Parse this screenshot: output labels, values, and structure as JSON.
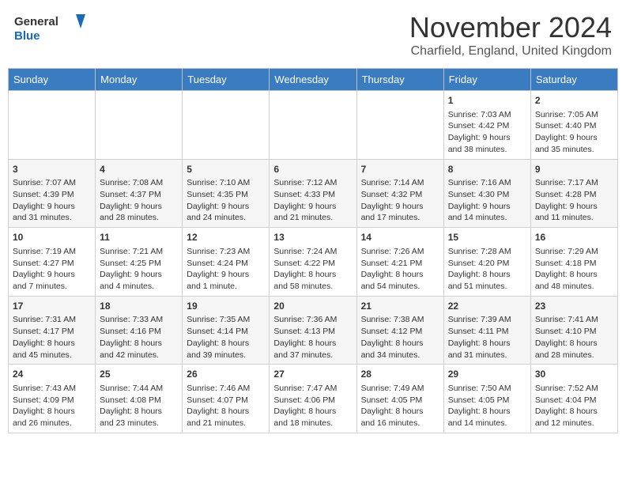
{
  "header": {
    "logo_general": "General",
    "logo_blue": "Blue",
    "month_title": "November 2024",
    "location": "Charfield, England, United Kingdom"
  },
  "weekdays": [
    "Sunday",
    "Monday",
    "Tuesday",
    "Wednesday",
    "Thursday",
    "Friday",
    "Saturday"
  ],
  "weeks": [
    {
      "days": [
        {
          "number": "",
          "info": ""
        },
        {
          "number": "",
          "info": ""
        },
        {
          "number": "",
          "info": ""
        },
        {
          "number": "",
          "info": ""
        },
        {
          "number": "",
          "info": ""
        },
        {
          "number": "1",
          "info": "Sunrise: 7:03 AM\nSunset: 4:42 PM\nDaylight: 9 hours and 38 minutes."
        },
        {
          "number": "2",
          "info": "Sunrise: 7:05 AM\nSunset: 4:40 PM\nDaylight: 9 hours and 35 minutes."
        }
      ]
    },
    {
      "days": [
        {
          "number": "3",
          "info": "Sunrise: 7:07 AM\nSunset: 4:39 PM\nDaylight: 9 hours and 31 minutes."
        },
        {
          "number": "4",
          "info": "Sunrise: 7:08 AM\nSunset: 4:37 PM\nDaylight: 9 hours and 28 minutes."
        },
        {
          "number": "5",
          "info": "Sunrise: 7:10 AM\nSunset: 4:35 PM\nDaylight: 9 hours and 24 minutes."
        },
        {
          "number": "6",
          "info": "Sunrise: 7:12 AM\nSunset: 4:33 PM\nDaylight: 9 hours and 21 minutes."
        },
        {
          "number": "7",
          "info": "Sunrise: 7:14 AM\nSunset: 4:32 PM\nDaylight: 9 hours and 17 minutes."
        },
        {
          "number": "8",
          "info": "Sunrise: 7:16 AM\nSunset: 4:30 PM\nDaylight: 9 hours and 14 minutes."
        },
        {
          "number": "9",
          "info": "Sunrise: 7:17 AM\nSunset: 4:28 PM\nDaylight: 9 hours and 11 minutes."
        }
      ]
    },
    {
      "days": [
        {
          "number": "10",
          "info": "Sunrise: 7:19 AM\nSunset: 4:27 PM\nDaylight: 9 hours and 7 minutes."
        },
        {
          "number": "11",
          "info": "Sunrise: 7:21 AM\nSunset: 4:25 PM\nDaylight: 9 hours and 4 minutes."
        },
        {
          "number": "12",
          "info": "Sunrise: 7:23 AM\nSunset: 4:24 PM\nDaylight: 9 hours and 1 minute."
        },
        {
          "number": "13",
          "info": "Sunrise: 7:24 AM\nSunset: 4:22 PM\nDaylight: 8 hours and 58 minutes."
        },
        {
          "number": "14",
          "info": "Sunrise: 7:26 AM\nSunset: 4:21 PM\nDaylight: 8 hours and 54 minutes."
        },
        {
          "number": "15",
          "info": "Sunrise: 7:28 AM\nSunset: 4:20 PM\nDaylight: 8 hours and 51 minutes."
        },
        {
          "number": "16",
          "info": "Sunrise: 7:29 AM\nSunset: 4:18 PM\nDaylight: 8 hours and 48 minutes."
        }
      ]
    },
    {
      "days": [
        {
          "number": "17",
          "info": "Sunrise: 7:31 AM\nSunset: 4:17 PM\nDaylight: 8 hours and 45 minutes."
        },
        {
          "number": "18",
          "info": "Sunrise: 7:33 AM\nSunset: 4:16 PM\nDaylight: 8 hours and 42 minutes."
        },
        {
          "number": "19",
          "info": "Sunrise: 7:35 AM\nSunset: 4:14 PM\nDaylight: 8 hours and 39 minutes."
        },
        {
          "number": "20",
          "info": "Sunrise: 7:36 AM\nSunset: 4:13 PM\nDaylight: 8 hours and 37 minutes."
        },
        {
          "number": "21",
          "info": "Sunrise: 7:38 AM\nSunset: 4:12 PM\nDaylight: 8 hours and 34 minutes."
        },
        {
          "number": "22",
          "info": "Sunrise: 7:39 AM\nSunset: 4:11 PM\nDaylight: 8 hours and 31 minutes."
        },
        {
          "number": "23",
          "info": "Sunrise: 7:41 AM\nSunset: 4:10 PM\nDaylight: 8 hours and 28 minutes."
        }
      ]
    },
    {
      "days": [
        {
          "number": "24",
          "info": "Sunrise: 7:43 AM\nSunset: 4:09 PM\nDaylight: 8 hours and 26 minutes."
        },
        {
          "number": "25",
          "info": "Sunrise: 7:44 AM\nSunset: 4:08 PM\nDaylight: 8 hours and 23 minutes."
        },
        {
          "number": "26",
          "info": "Sunrise: 7:46 AM\nSunset: 4:07 PM\nDaylight: 8 hours and 21 minutes."
        },
        {
          "number": "27",
          "info": "Sunrise: 7:47 AM\nSunset: 4:06 PM\nDaylight: 8 hours and 18 minutes."
        },
        {
          "number": "28",
          "info": "Sunrise: 7:49 AM\nSunset: 4:05 PM\nDaylight: 8 hours and 16 minutes."
        },
        {
          "number": "29",
          "info": "Sunrise: 7:50 AM\nSunset: 4:05 PM\nDaylight: 8 hours and 14 minutes."
        },
        {
          "number": "30",
          "info": "Sunrise: 7:52 AM\nSunset: 4:04 PM\nDaylight: 8 hours and 12 minutes."
        }
      ]
    }
  ]
}
